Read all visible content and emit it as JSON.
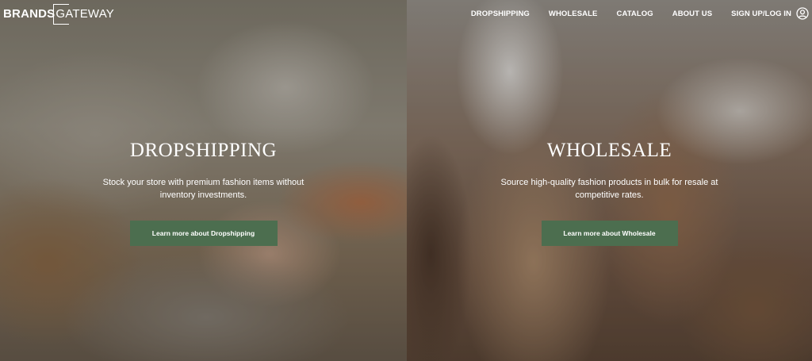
{
  "brand": {
    "logo_bold": "BRANDS",
    "logo_light": "GATEWAY"
  },
  "nav": {
    "items": [
      {
        "label": "DROPSHIPPING"
      },
      {
        "label": "WHOLESALE"
      },
      {
        "label": "CATALOG"
      },
      {
        "label": "ABOUT US"
      },
      {
        "label": "SIGN UP/LOG IN"
      }
    ],
    "user_icon": "user-circle-icon"
  },
  "hero": {
    "dropshipping": {
      "title": "DROPSHIPPING",
      "description": "Stock your store with premium fashion items without inventory investments.",
      "button_label": "Learn more about Dropshipping"
    },
    "wholesale": {
      "title": "WHOLESALE",
      "description": "Source high-quality fashion products in bulk for resale at competitive rates.",
      "button_label": "Learn more about Wholesale"
    }
  },
  "colors": {
    "button_green": "#4c6e4f",
    "text": "#ffffff"
  }
}
